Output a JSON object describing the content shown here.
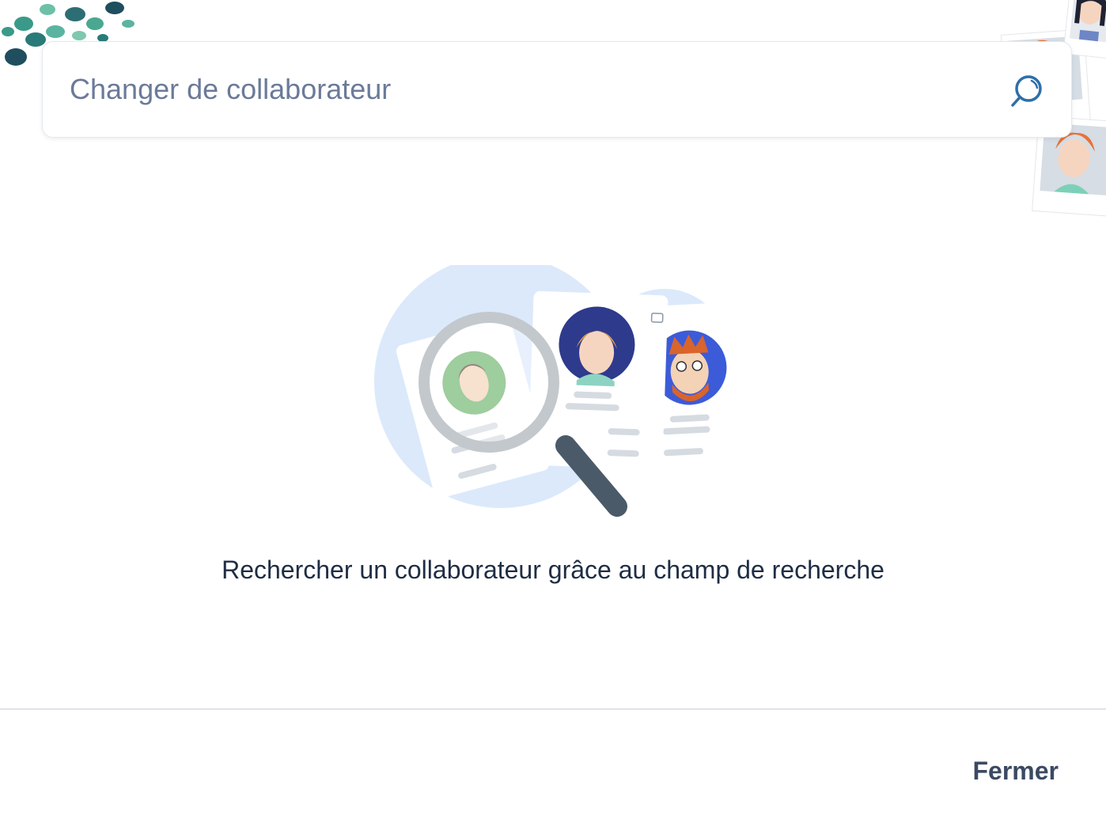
{
  "search": {
    "placeholder": "Changer de collaborateur",
    "value": "",
    "icon": "search-icon"
  },
  "empty_state": {
    "message": "Rechercher un collaborateur grâce au champ de recherche",
    "illustration": "magnifier-over-profile-cards"
  },
  "footer": {
    "close_label": "Fermer"
  },
  "colors": {
    "accent_blue": "#2f6fa8",
    "text_dark": "#1f2d44",
    "placeholder": "#6b7a99",
    "illustration_bg": "#dbe9fb"
  }
}
